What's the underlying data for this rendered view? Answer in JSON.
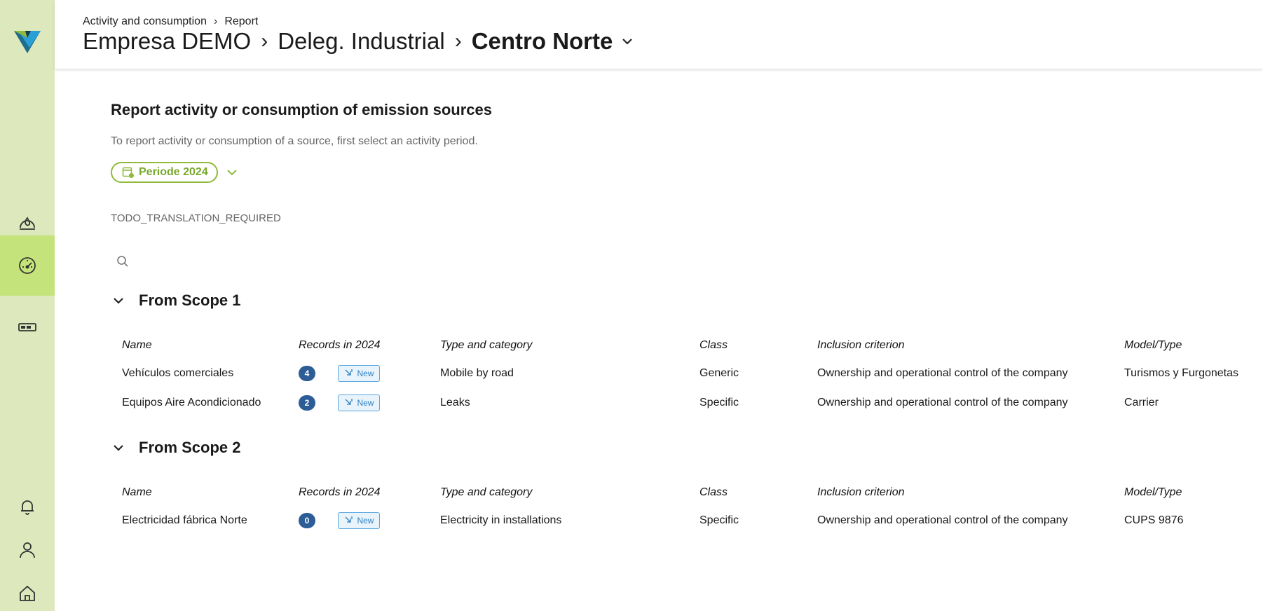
{
  "header": {
    "crumb_small": [
      "Activity and consumption",
      "Report"
    ],
    "crumb_big": [
      "Empresa DEMO",
      "Deleg. Industrial"
    ],
    "current": "Centro Norte"
  },
  "main": {
    "title": "Report activity or consumption of emission sources",
    "subtitle": "To report activity or consumption of a source, first select an activity period.",
    "period": "Periode 2024",
    "todo": "TODO_TRANSLATION_REQUIRED",
    "search_placeholder": ""
  },
  "columns": {
    "name": "Name",
    "records": "Records in 2024",
    "type": "Type and category",
    "class": "Class",
    "inclusion": "Inclusion criterion",
    "model": "Model/Type"
  },
  "new_label": "New",
  "scopes": [
    {
      "title": "From Scope 1",
      "rows": [
        {
          "name": "Vehículos comerciales",
          "count": "4",
          "type": "Mobile by road",
          "class": "Generic",
          "inclusion": "Ownership and operational control of the company",
          "model": "Turismos y Furgonetas"
        },
        {
          "name": "Equipos Aire Acondicionado",
          "count": "2",
          "type": "Leaks",
          "class": "Specific",
          "inclusion": "Ownership and operational control of the company",
          "model": "Carrier"
        }
      ]
    },
    {
      "title": "From Scope 2",
      "rows": [
        {
          "name": "Electricidad fábrica Norte",
          "count": "0",
          "type": "Electricity in installations",
          "class": "Specific",
          "inclusion": "Ownership and operational control of the company",
          "model": "CUPS 9876"
        }
      ]
    }
  ],
  "colors": {
    "sidebar": "#dde9bd",
    "sidebar_active": "#c4e37a",
    "accent_green": "#8fba3c",
    "badge_blue": "#2c5d96",
    "new_blue": "#2b7fc4"
  },
  "icons": {
    "logo": "brand-logo-icon",
    "sidebar": [
      "emissions-icon",
      "dashboard-gauge-icon",
      "battery-icon",
      "bell-icon",
      "user-icon",
      "home-icon"
    ]
  }
}
